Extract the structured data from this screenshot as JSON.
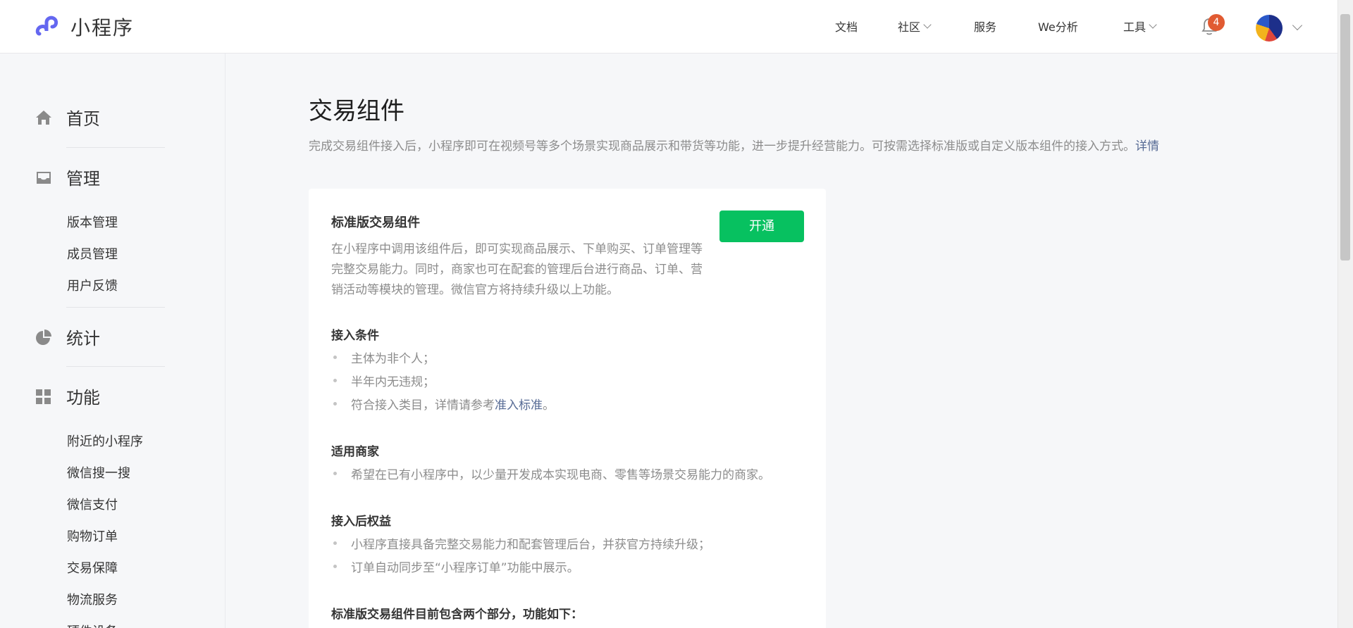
{
  "app": {
    "name": "小程序",
    "brand_color": "#6467f0"
  },
  "nav": {
    "docs": "文档",
    "community": "社区",
    "service": "服务",
    "we_analytics": "We分析",
    "tools": "工具",
    "notification_count": "4",
    "bell_icon": "bell-icon",
    "avatar_icon": "user-avatar"
  },
  "sidebar": {
    "home": {
      "label": "首页",
      "icon": "home-icon"
    },
    "manage": {
      "label": "管理",
      "icon": "inbox-icon",
      "items": [
        "版本管理",
        "成员管理",
        "用户反馈"
      ]
    },
    "stats": {
      "label": "统计",
      "icon": "pie-chart-icon"
    },
    "features": {
      "label": "功能",
      "icon": "grid-icon",
      "items": [
        "附近的小程序",
        "微信搜一搜",
        "微信支付",
        "购物订单",
        "交易保障",
        "物流服务",
        "硬件设备"
      ]
    }
  },
  "main": {
    "title": "交易组件",
    "description": "完成交易组件接入后，小程序即可在视频号等多个场景实现商品展示和带货等功能，进一步提升经营能力。可按需选择标准版或自定义版本组件的接入方式。",
    "detail_link": "详情",
    "card": {
      "title": "标准版交易组件",
      "description": "在小程序中调用该组件后，即可实现商品展示、下单购买、订单管理等完整交易能力。同时，商家也可在配套的管理后台进行商品、订单、营销活动等模块的管理。微信官方将持续升级以上功能。",
      "button": "开通",
      "button_color": "#07c160",
      "conditions_title": "接入条件",
      "conditions": [
        "主体为非个人；",
        "半年内无违规；",
        "符合接入类目，详情请参考"
      ],
      "conditions_link": "准入标准",
      "conditions_end": "。",
      "merchants_title": "适用商家",
      "merchants": [
        "希望在已有小程序中，以少量开发成本实现电商、零售等场景交易能力的商家。"
      ],
      "benefits_title": "接入后权益",
      "benefits": [
        "小程序直接具备完整交易能力和配套管理后台，并获官方持续升级；",
        "订单自动同步至“小程序订单”功能中展示。"
      ],
      "parts_title": "标准版交易组件目前包含两个部分，功能如下："
    }
  }
}
